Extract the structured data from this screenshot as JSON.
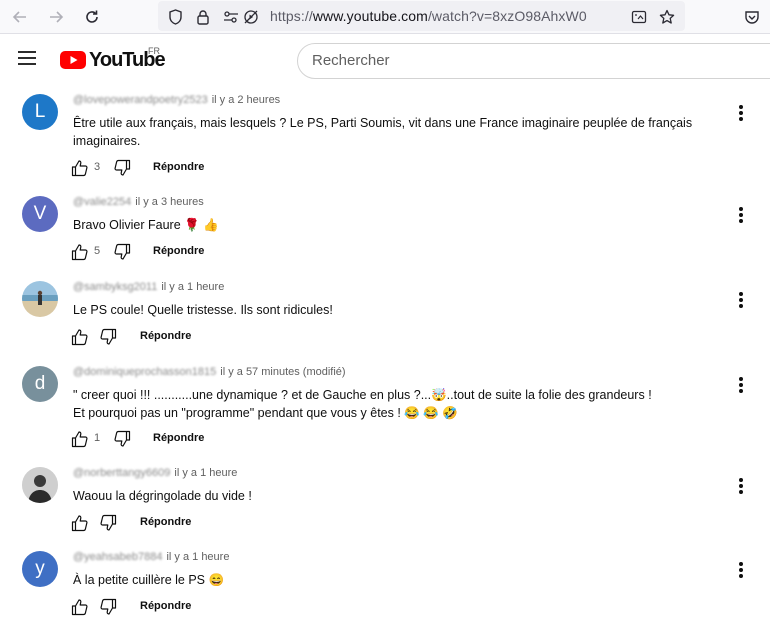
{
  "browser": {
    "url_domain": "www.youtube.com",
    "url_path": "/watch?v=8xzO98AhxW0",
    "url_scheme": "https://"
  },
  "header": {
    "logo_text": "YouTube",
    "country_code": "FR",
    "search_placeholder": "Rechercher"
  },
  "comments": [
    {
      "author": "@lovepowerandpoetry2523",
      "time": "il y a 2 heures",
      "text": "Être utile aux français, mais lesquels ? Le PS, Parti Soumis, vit dans une France imaginaire peuplée de français\nimaginaires.",
      "likes": "3",
      "reply_label": "Répondre",
      "avatar_letter": "L",
      "avatar_color": "#1e78c8"
    },
    {
      "author": "@valie2254",
      "time": "il y a 3 heures",
      "text": "Bravo Olivier Faure 🌹 👍",
      "likes": "5",
      "reply_label": "Répondre",
      "avatar_letter": "V",
      "avatar_color": "#5c6bc0"
    },
    {
      "author": "@sambyksg2011",
      "time": "il y a 1 heure",
      "text": "Le PS coule! Quelle tristesse. Ils sont ridicules!",
      "likes": "",
      "reply_label": "Répondre",
      "avatar_letter": "",
      "avatar_color": "#8fb5cf"
    },
    {
      "author": "@dominiqueprochasson1815",
      "time": "il y a 57 minutes (modifié)",
      "text": "\" creer quoi  !!!  ...........une dynamique ?   et de Gauche en plus ?...🤯..tout de suite la folie des grandeurs !\nEt pourquoi pas un \"programme\" pendant que vous y êtes ! 😂 😂 🤣",
      "likes": "1",
      "reply_label": "Répondre",
      "avatar_letter": "d",
      "avatar_color": "#78909c"
    },
    {
      "author": "@norberttangy6609",
      "time": "il y a 1 heure",
      "text": "Waouu la dégringolade du vide !",
      "likes": "",
      "reply_label": "Répondre",
      "avatar_letter": "",
      "avatar_color": "#555555"
    },
    {
      "author": "@yeahsabeb7884",
      "time": "il y a 1 heure",
      "text": "À la petite cuillère le PS 😄",
      "likes": "",
      "reply_label": "Répondre",
      "avatar_letter": "y",
      "avatar_color": "#3f6fc4"
    }
  ]
}
